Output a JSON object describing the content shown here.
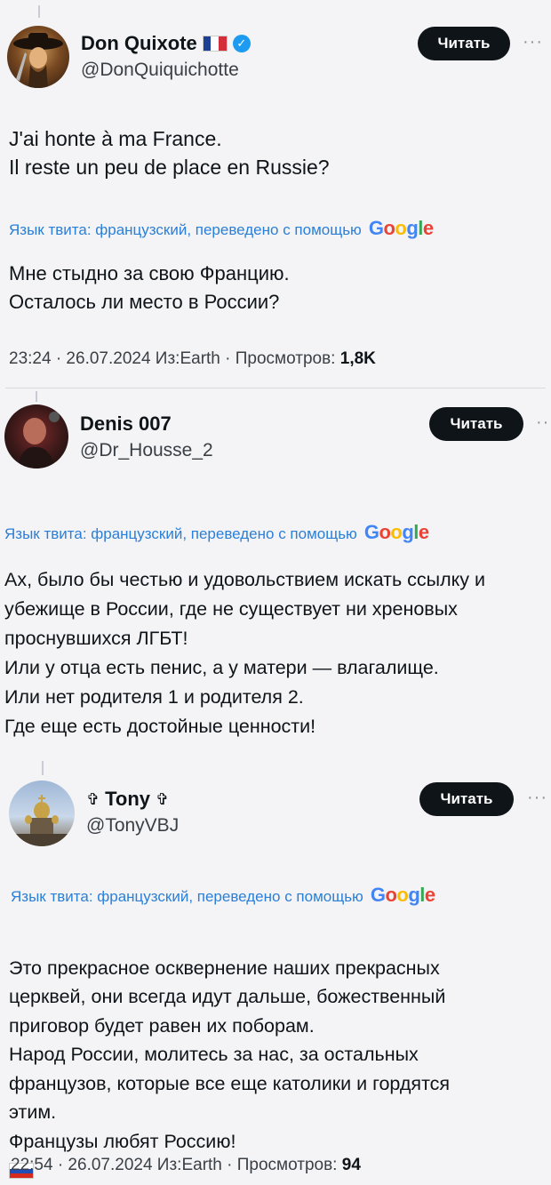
{
  "colors": {
    "accent": "#2a7fd8",
    "verified": "#1d9bf0",
    "button_bg": "#0f1419"
  },
  "tweets": [
    {
      "name": "Don Quixote",
      "handle": "@DonQuiquichotte",
      "verified": true,
      "name_flag": "france-flag",
      "follow_label": "Читать",
      "more": "···",
      "text": "J'ai honte à ma France.\nIl reste un peu de place en Russie?",
      "translate_note": "Язык твита: французский, переведено с помощью",
      "translated_text": "Мне стыдно за свою Францию.\nОсталось ли место в России?",
      "time": "23:24 · 26.07.2024 Из:Earth · Просмотров:",
      "views": "1,8K"
    },
    {
      "name": "Denis 007",
      "handle": "@Dr_Housse_2",
      "follow_label": "Читать",
      "more": "··",
      "translate_note": "Язык твита: французский, переведено с помощью",
      "translated_text": "Ах, было бы честью и удовольствием искать ссылку и\nубежище в России, где не существует ни хреновых\nпроснувшихся ЛГБТ!\nИли у отца есть пенис, а у матери — влагалище.\nИли нет родителя 1 и родителя 2.\nГде еще есть достойные ценности!"
    },
    {
      "name": "Tony",
      "name_prefix": "✞",
      "name_suffix": "✞",
      "handle": "@TonyVBJ",
      "follow_label": "Читать",
      "more": "···",
      "translate_note": "Язык твита: французский, переведено с помощью",
      "translated_text": "Это прекрасное осквернение наших прекрасных\nцерквей, они всегда идут дальше, божественный\nприговор будет равен их поборам.\nНарод России, молитесь за нас, за остальных\nфранцузов, которые все еще католики и гордятся\nэтим.\nФранцузы любят Россию!",
      "translated_flag": "russia-flag",
      "time": "22:54 · 26.07.2024 Из:Earth · Просмотров:",
      "views": "94"
    }
  ],
  "google_logo": [
    "G",
    "o",
    "o",
    "g",
    "l",
    "e"
  ]
}
